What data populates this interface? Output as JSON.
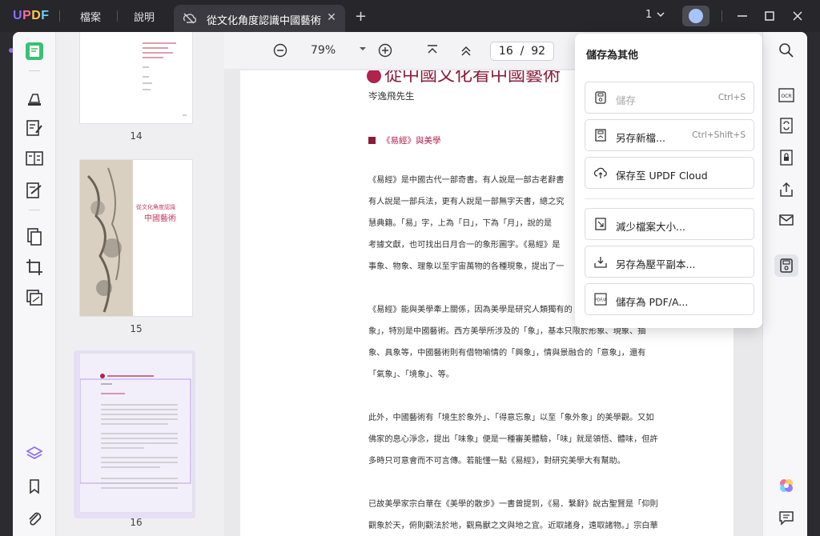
{
  "app": {
    "logo_letters": [
      "U",
      "P",
      "D",
      "F"
    ]
  },
  "menu": {
    "file": "檔案",
    "help": "說明"
  },
  "tab": {
    "title": "從文化角度認識中國藝術",
    "close": "✕"
  },
  "new_tab": "+",
  "window": {
    "page_indicator": "1"
  },
  "toolbar": {
    "zoom": "79%",
    "page_current": "16",
    "page_sep": "/",
    "page_total": "92"
  },
  "thumbnails": [
    {
      "page": "14"
    },
    {
      "page": "15",
      "cover_title": "從文化角度認識",
      "cover_subtitle": "中國藝術"
    },
    {
      "page": "16"
    }
  ],
  "document": {
    "title": "從中國文化看中國藝術",
    "author": "岑逸飛先生",
    "section": "《易經》與美學",
    "lines": [
      "《易經》是中國古代一部奇書。有人說是一部古老辭書",
      "有人說是一部兵法，更有人說是一部無字天書，總之究",
      "慧典籍。「易」字，上為「日」，下為「月」，說的是",
      "考據文獻，也可找出日月合一的象形圖字。《易經》是",
      "事象、物象、理象以至宇宙萬物的各種現象，提出了一",
      "",
      "《易經》能與美學牽上關係，因為美學是研究人類獨有的",
      "象」，特別是中國藝術。西方美學所涉及的「象」，基本只限於形象、現象、抽",
      "象、具象等，中國藝術則有借物喻情的「興象」，情與景融合的「意象」，還有",
      "「氣象」、「境象」、等。",
      "",
      "此外，中國藝術有「境生於象外」、「得意忘象」以至「象外象」的美學觀。又如",
      "佛家的息心淨念，提出「味象」便是一種審美體驗，「味」就是領悟、體味，但許",
      "多時只可意會而不可言傳。若能懂一點《易經》，對研究美學大有幫助。",
      "",
      "已故美學家宗白華在《美學的散步》一書曾提到，《易．繫辭》說古聖賢是「仰則",
      "觀象於天，俯則觀法於地，觀鳥獸之文與地之宜。近取諸身，遠取諸物。」宗白華"
    ]
  },
  "save_menu": {
    "title": "儲存為其他",
    "items": [
      {
        "label": "儲存",
        "shortcut": "Ctrl+S",
        "disabled": true,
        "icon": "save-icon"
      },
      {
        "label": "另存新檔...",
        "shortcut": "Ctrl+Shift+S",
        "disabled": false,
        "icon": "save-as-icon"
      },
      {
        "label": "保存至 UPDF Cloud",
        "shortcut": "",
        "disabled": false,
        "icon": "cloud-upload-icon"
      },
      {
        "label": "減少檔案大小...",
        "shortcut": "",
        "disabled": false,
        "icon": "compress-icon"
      },
      {
        "label": "另存為壓平副本...",
        "shortcut": "",
        "disabled": false,
        "icon": "flatten-icon"
      },
      {
        "label": "儲存為 PDF/A...",
        "shortcut": "",
        "disabled": false,
        "icon": "pdfa-icon"
      }
    ]
  },
  "colors": {
    "accent": "#8c6cff",
    "doc_red": "#b0234c",
    "titlebar": "#26262b"
  }
}
